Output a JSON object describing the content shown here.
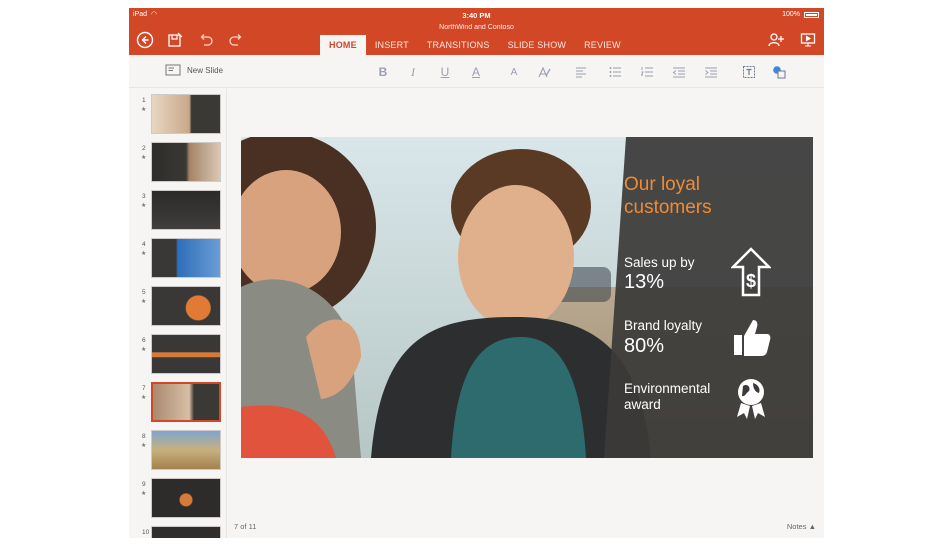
{
  "status": {
    "carrier": "iPad",
    "time": "3:40 PM",
    "battery": "100%"
  },
  "document": {
    "title": "NorthWind and Contoso"
  },
  "header": {
    "icons": [
      "back-icon",
      "save-icon",
      "undo-icon",
      "redo-icon",
      "share-person-icon",
      "present-icon"
    ],
    "tabs": [
      {
        "label": "HOME",
        "active": true
      },
      {
        "label": "INSERT",
        "active": false
      },
      {
        "label": "TRANSITIONS",
        "active": false
      },
      {
        "label": "SLIDE SHOW",
        "active": false
      },
      {
        "label": "REVIEW",
        "active": false
      }
    ]
  },
  "toolbar": {
    "new_slide_label": "New Slide",
    "bold": "B",
    "italic": "I",
    "underline": "U",
    "font_color": "A",
    "font_size": "A"
  },
  "thumbnails": {
    "selected_index": 7,
    "numbers": [
      "1",
      "2",
      "3",
      "4",
      "5",
      "6",
      "7",
      "8",
      "9",
      "10"
    ]
  },
  "slide": {
    "title": "Our loyal customers",
    "stats": [
      {
        "label": "Sales up by",
        "value": "13%",
        "icon": "dollar-arrow-icon"
      },
      {
        "label": "Brand loyalty",
        "value": "80%",
        "icon": "thumbs-up-icon"
      },
      {
        "label": "Environmental award",
        "value": "",
        "icon": "globe-award-icon"
      }
    ]
  },
  "footer": {
    "page_indicator": "7 of 11",
    "notes_label": "Notes"
  },
  "colors": {
    "accent": "#d24726",
    "slide_title": "#f08a35"
  }
}
